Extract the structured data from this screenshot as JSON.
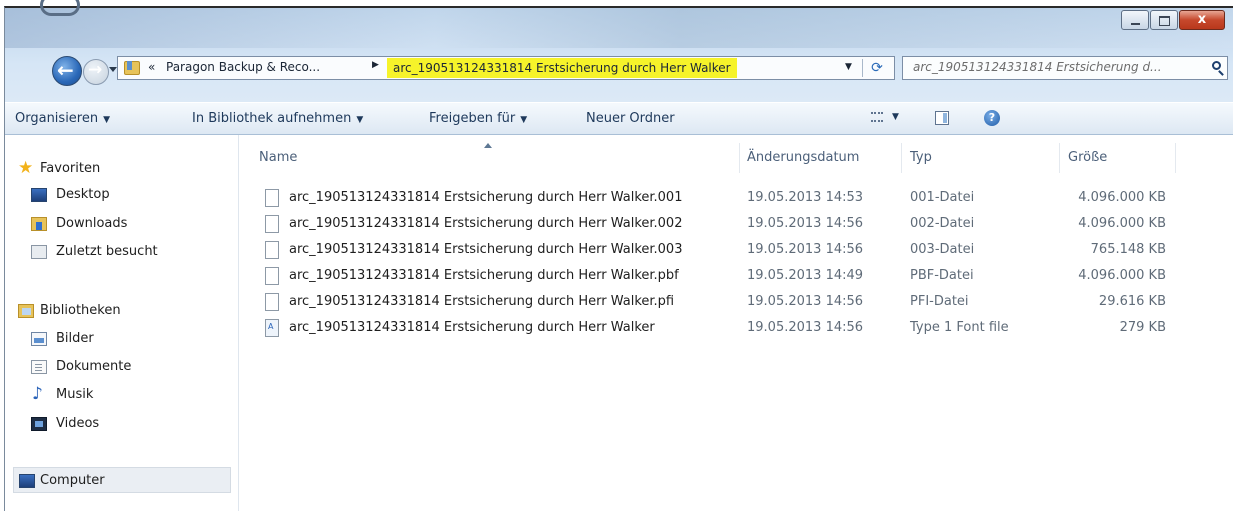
{
  "window": {
    "controls": [
      {
        "name": "minimize-button",
        "label": ""
      },
      {
        "name": "maximize-button",
        "label": ""
      },
      {
        "name": "close-button",
        "label": "x"
      }
    ]
  },
  "address_bar": {
    "chevron": "«",
    "segment1": "Paragon Backup & Reco...",
    "segment2": "arc_190513124331814 Erstsicherung durch Herr Walker",
    "highlight_color": "#f6f32a"
  },
  "search": {
    "placeholder": "arc_190513124331814 Erstsicherung d..."
  },
  "toolbar": {
    "organize": "Organisieren",
    "library": "In Bibliothek aufnehmen",
    "share": "Freigeben für",
    "new_folder": "Neuer Ordner",
    "help": "?"
  },
  "sidebar": {
    "favorites": {
      "label": "Favoriten",
      "icon": "star-icon"
    },
    "fav_items": [
      {
        "label": "Desktop",
        "icon": "desktop-icon"
      },
      {
        "label": "Downloads",
        "icon": "downloads-folder-icon"
      },
      {
        "label": "Zuletzt besucht",
        "icon": "recent-places-icon"
      }
    ],
    "libraries": {
      "label": "Bibliotheken",
      "icon": "libraries-icon"
    },
    "lib_items": [
      {
        "label": "Bilder",
        "icon": "pictures-icon"
      },
      {
        "label": "Dokumente",
        "icon": "documents-icon"
      },
      {
        "label": "Musik",
        "icon": "music-icon"
      },
      {
        "label": "Videos",
        "icon": "videos-icon"
      }
    ],
    "computer": {
      "label": "Computer",
      "icon": "computer-icon"
    }
  },
  "columns": {
    "name": "Name",
    "date": "Änderungsdatum",
    "type": "Typ",
    "size": "Größe"
  },
  "files": [
    {
      "name": "arc_190513124331814 Erstsicherung durch Herr Walker.001",
      "date": "19.05.2013 14:53",
      "type": "001-Datei",
      "size": "4.096.000 KB",
      "icon": "file-icon"
    },
    {
      "name": "arc_190513124331814 Erstsicherung durch Herr Walker.002",
      "date": "19.05.2013 14:56",
      "type": "002-Datei",
      "size": "4.096.000 KB",
      "icon": "file-icon"
    },
    {
      "name": "arc_190513124331814 Erstsicherung durch Herr Walker.003",
      "date": "19.05.2013 14:56",
      "type": "003-Datei",
      "size": "765.148 KB",
      "icon": "file-icon"
    },
    {
      "name": "arc_190513124331814 Erstsicherung durch Herr Walker.pbf",
      "date": "19.05.2013 14:49",
      "type": "PBF-Datei",
      "size": "4.096.000 KB",
      "icon": "file-icon"
    },
    {
      "name": "arc_190513124331814 Erstsicherung durch Herr Walker.pfi",
      "date": "19.05.2013 14:56",
      "type": "PFI-Datei",
      "size": "29.616 KB",
      "icon": "file-icon"
    },
    {
      "name": "arc_190513124331814 Erstsicherung durch Herr Walker",
      "date": "19.05.2013 14:56",
      "type": "Type 1 Font file",
      "size": "279 KB",
      "icon": "font-file-icon"
    }
  ]
}
